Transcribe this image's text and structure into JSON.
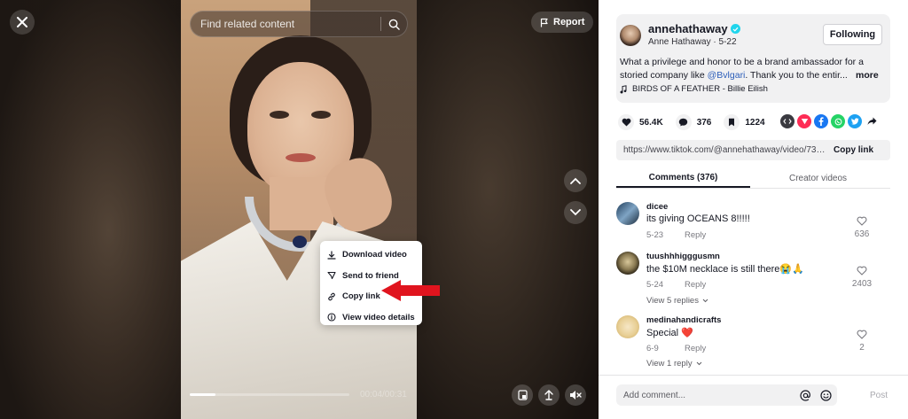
{
  "player": {
    "search_placeholder": "Find related content",
    "report_label": "Report",
    "time_label": "00:04/00:31",
    "progress": 0.16
  },
  "context_menu": {
    "items": [
      {
        "label": "Download video",
        "icon": "download-icon"
      },
      {
        "label": "Send to friend",
        "icon": "send-icon"
      },
      {
        "label": "Copy link",
        "icon": "link-icon"
      },
      {
        "label": "View video details",
        "icon": "info-icon"
      }
    ]
  },
  "post": {
    "username": "annehathaway",
    "display_name": "Anne Hathaway",
    "separator": "·",
    "date": "5-22",
    "follow_label": "Following",
    "caption_prefix": "What a privilege and honor to be a brand ambassador for a storied company like ",
    "caption_mention": "@Bvlgari",
    "caption_suffix": ". Thank you to the entir...",
    "more_label": "more",
    "music": "BIRDS OF A FEATHER - Billie Eilish",
    "likes": "56.4K",
    "comments_count": "376",
    "saves": "1224",
    "link": "https://www.tiktok.com/@annehathaway/video/73718...",
    "copy_link_label": "Copy link"
  },
  "share_colors": {
    "embed": "#3a3a40",
    "repost": "#fe2c55",
    "facebook": "#1877f2",
    "whatsapp": "#25d366",
    "twitter": "#1da1f2"
  },
  "tabs": {
    "comments": "Comments (376)",
    "creator_videos": "Creator videos"
  },
  "comments": [
    {
      "user": "dicee",
      "text": "its giving OCEANS 8!!!!!",
      "date": "5-23",
      "reply": "Reply",
      "likes": "636",
      "view_replies": ""
    },
    {
      "user": "tuushhhigggusmn",
      "text": "the $10M necklace is still there😭🙏",
      "date": "5-24",
      "reply": "Reply",
      "likes": "2403",
      "view_replies": "View 5 replies"
    },
    {
      "user": "medinahandicrafts",
      "text": "Special ❤️",
      "date": "6-9",
      "reply": "Reply",
      "likes": "2",
      "view_replies": "View 1 reply"
    }
  ],
  "composer": {
    "placeholder": "Add comment...",
    "post_label": "Post"
  }
}
